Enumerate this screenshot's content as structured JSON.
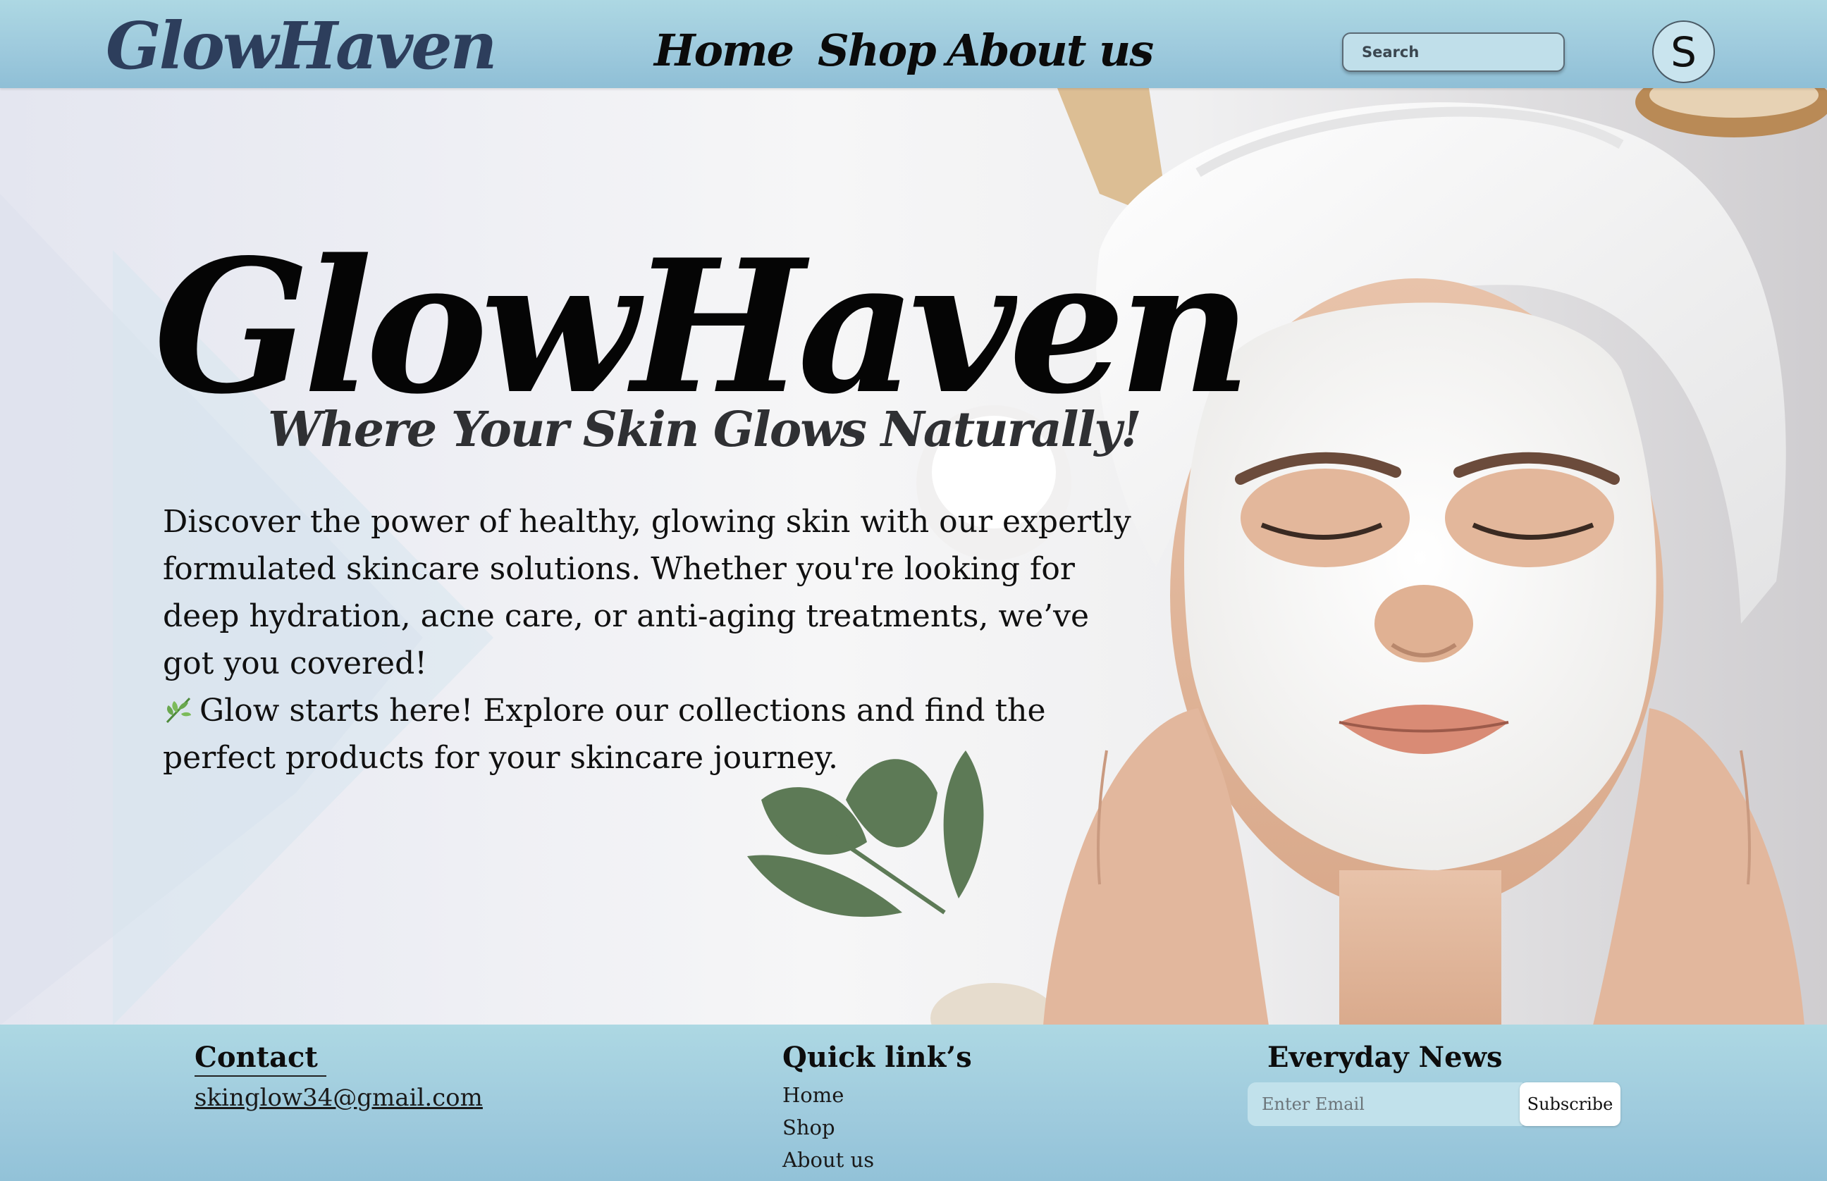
{
  "header": {
    "logo": "GlowHaven",
    "nav": {
      "home": "Home",
      "shop": "Shop",
      "about": "About us"
    },
    "search": {
      "placeholder": "Search"
    },
    "avatar_initial": "S"
  },
  "hero": {
    "title": "GlowHaven",
    "tagline": "Where Your Skin Glows Naturally!",
    "paragraph_1": "Discover the power of healthy, glowing skin with our expertly formulated skincare solutions. Whether you're looking for deep hydration, acne care, or anti-aging treatments, we’ve got you covered!",
    "paragraph_2": "Glow starts here! Explore our collections and find the perfect products for your skincare journey.",
    "image_icon": "face-mask-woman-photo"
  },
  "footer": {
    "contact": {
      "heading": "Contact",
      "email": "skinglow34@gmail.com"
    },
    "quick_links": {
      "heading": "Quick link’s",
      "items": [
        "Home",
        "Shop",
        "About us"
      ]
    },
    "newsletter": {
      "heading": "Everyday News",
      "placeholder": "Enter Email",
      "button": "Subscribe"
    }
  },
  "colors": {
    "header_bg": "#a8d4e2",
    "footer_bg": "#a8d4e2",
    "logo_color": "#2d3e5c",
    "text_dark": "#0b0b0b"
  }
}
